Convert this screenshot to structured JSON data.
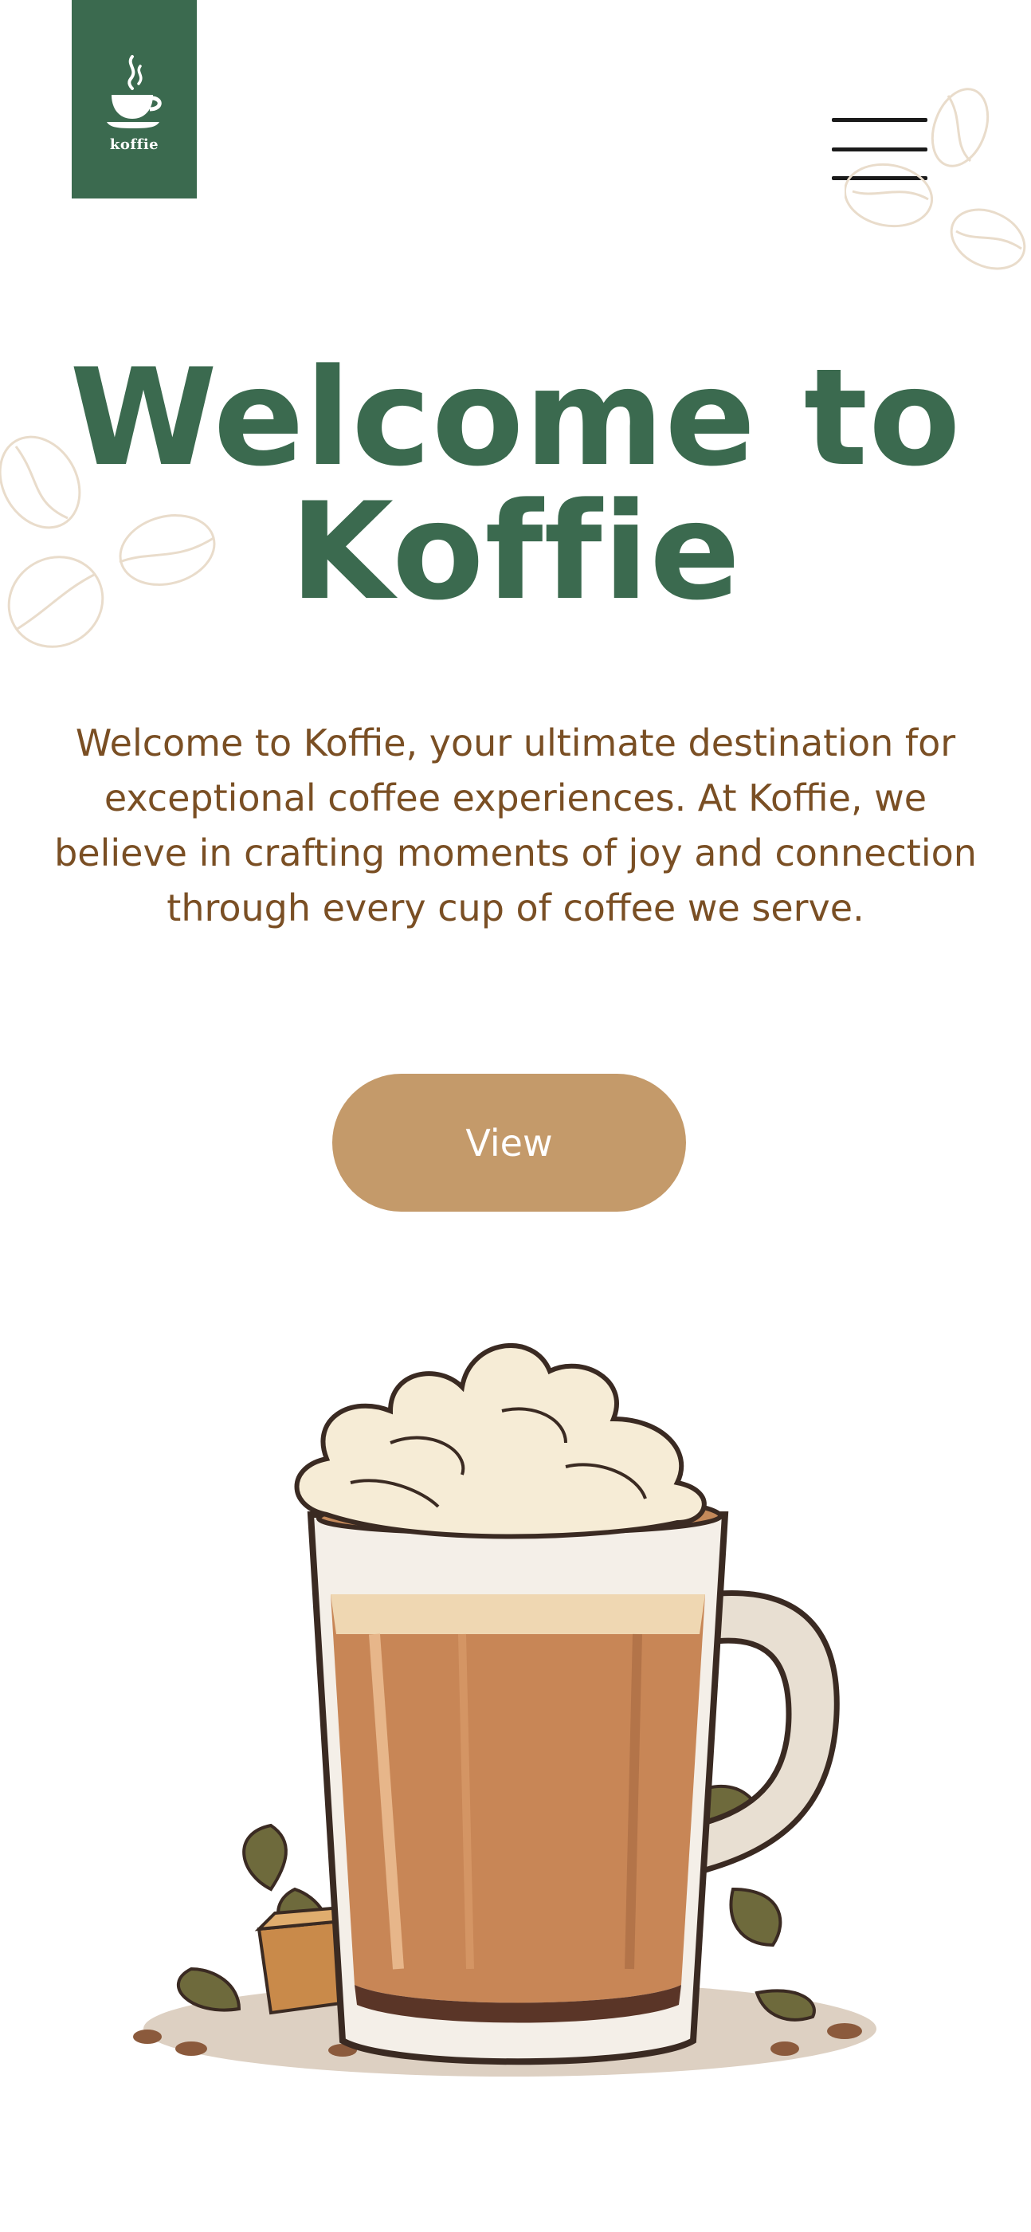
{
  "brand": {
    "logo_text": "koffie",
    "logo_color": "#3b6a4f"
  },
  "nav": {
    "menu_icon": "hamburger-menu-icon"
  },
  "hero": {
    "title_line1": "Welcome to",
    "title_line2": "Koffie",
    "description": "Welcome to Koffie, your ultimate destination for exceptional coffee experiences. At Koffie, we believe in crafting moments of joy and connection through every cup of coffee we serve.",
    "cta_label": "View",
    "accent_color": "#c49a6a",
    "text_color": "#7a4f24"
  },
  "illustration": {
    "name": "coffee-latte-mug-illustration"
  }
}
